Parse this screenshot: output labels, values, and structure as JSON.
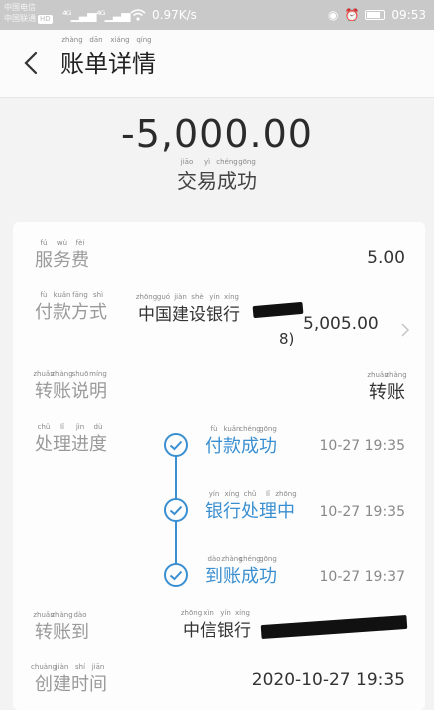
{
  "status_bar": {
    "carrier_line1": "中国电信",
    "carrier_line2": "中国联通",
    "hd_badge": "HD",
    "network_speed": "0.97K/s",
    "time": "09:53",
    "icons": [
      "signal-icon",
      "wifi-icon",
      "eye-icon",
      "alarm-icon",
      "battery-icon"
    ]
  },
  "header": {
    "back_icon": "chevron-left-icon",
    "title": [
      {
        "ch": "账",
        "py": "zhàng"
      },
      {
        "ch": "单",
        "py": "dān"
      },
      {
        "ch": "详",
        "py": "xiáng"
      },
      {
        "ch": "情",
        "py": "qíng"
      }
    ]
  },
  "summary": {
    "amount": "-5,000.00",
    "status": [
      {
        "ch": "交",
        "py": "jiāo"
      },
      {
        "ch": "易",
        "py": "yì"
      },
      {
        "ch": "成",
        "py": "chéng"
      },
      {
        "ch": "功",
        "py": "gōng"
      }
    ]
  },
  "details": {
    "service_fee": {
      "label": [
        {
          "ch": "服",
          "py": "fú"
        },
        {
          "ch": "务",
          "py": "wù"
        },
        {
          "ch": "费",
          "py": "fèi"
        }
      ],
      "value": "5.00"
    },
    "payment_method": {
      "label": [
        {
          "ch": "付",
          "py": "fù"
        },
        {
          "ch": "款",
          "py": "kuǎn"
        },
        {
          "ch": "方",
          "py": "fāng"
        },
        {
          "ch": "式",
          "py": "shì"
        }
      ],
      "bank": [
        {
          "ch": "中",
          "py": "zhōng"
        },
        {
          "ch": "国",
          "py": "guó"
        },
        {
          "ch": "建",
          "py": "jiàn"
        },
        {
          "ch": "设",
          "py": "shè"
        },
        {
          "ch": "银",
          "py": "yín"
        },
        {
          "ch": "行",
          "py": "xíng"
        }
      ],
      "card_suffix": "8)",
      "amount": "5,005.00"
    },
    "transfer_note": {
      "label": [
        {
          "ch": "转",
          "py": "zhuǎn"
        },
        {
          "ch": "账",
          "py": "zhàng"
        },
        {
          "ch": "说",
          "py": "shuō"
        },
        {
          "ch": "明",
          "py": "míng"
        }
      ],
      "value": [
        {
          "ch": "转",
          "py": "zhuǎn"
        },
        {
          "ch": "账",
          "py": "zhàng"
        }
      ]
    },
    "progress": {
      "label": [
        {
          "ch": "处",
          "py": "chǔ"
        },
        {
          "ch": "理",
          "py": "lǐ"
        },
        {
          "ch": "进",
          "py": "jìn"
        },
        {
          "ch": "度",
          "py": "dù"
        }
      ],
      "steps": [
        {
          "name": [
            {
              "ch": "付",
              "py": "fù"
            },
            {
              "ch": "款",
              "py": "kuǎn"
            },
            {
              "ch": "成",
              "py": "chéng"
            },
            {
              "ch": "功",
              "py": "gōng"
            }
          ],
          "time": "10-27 19:35"
        },
        {
          "name": [
            {
              "ch": "银",
              "py": "yín"
            },
            {
              "ch": "行",
              "py": "xíng"
            },
            {
              "ch": "处",
              "py": "chǔ"
            },
            {
              "ch": "理",
              "py": "lǐ"
            },
            {
              "ch": "中",
              "py": "zhōng"
            }
          ],
          "time": "10-27 19:35"
        },
        {
          "name": [
            {
              "ch": "到",
              "py": "dào"
            },
            {
              "ch": "账",
              "py": "zhàng"
            },
            {
              "ch": "成",
              "py": "chéng"
            },
            {
              "ch": "功",
              "py": "gōng"
            }
          ],
          "time": "10-27 19:37"
        }
      ]
    },
    "transfer_to": {
      "label": [
        {
          "ch": "转",
          "py": "zhuǎn"
        },
        {
          "ch": "账",
          "py": "zhàng"
        },
        {
          "ch": "到",
          "py": "dào"
        }
      ],
      "bank": [
        {
          "ch": "中",
          "py": "zhōng"
        },
        {
          "ch": "信",
          "py": "xìn"
        },
        {
          "ch": "银",
          "py": "yín"
        },
        {
          "ch": "行",
          "py": "xíng"
        }
      ]
    },
    "created_time": {
      "label": [
        {
          "ch": "创",
          "py": "chuàng"
        },
        {
          "ch": "建",
          "py": "jiàn"
        },
        {
          "ch": "时",
          "py": "shí"
        },
        {
          "ch": "间",
          "py": "jiān"
        }
      ],
      "value": "2020-10-27 19:35"
    }
  },
  "colors": {
    "accent": "#3a8fd1",
    "label": "#9a9a9a",
    "background": "#f3f3f3"
  }
}
